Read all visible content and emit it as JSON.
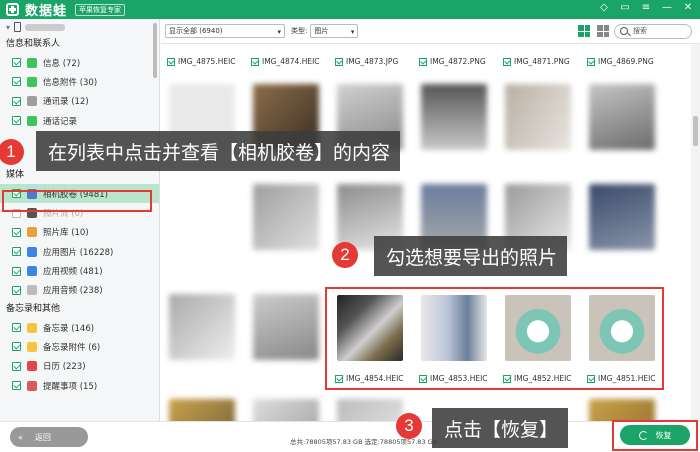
{
  "app": {
    "name": "数据蛙",
    "tag": "苹果恢复专家"
  },
  "window_buttons": [
    "diamond-icon",
    "chat-icon",
    "menu-icon",
    "minimize-icon",
    "close-icon"
  ],
  "sidebar": {
    "groups": [
      {
        "title": "信息和联系人",
        "items": [
          {
            "label": "信息 (72)",
            "checked": true,
            "color": "#3cc55c"
          },
          {
            "label": "信息附件 (30)",
            "checked": true,
            "color": "#3cc55c"
          },
          {
            "label": "通讯录 (12)",
            "checked": true,
            "color": "#9e9e9e"
          },
          {
            "label": "通话记录",
            "checked": true,
            "color": "#3cc55c"
          }
        ]
      },
      {
        "title": "媒体",
        "items": [
          {
            "label": "相机胶卷 (9481)",
            "checked": true,
            "color": "#4a7bd0",
            "active": true
          },
          {
            "label": "照片流 (0)",
            "checked": false,
            "color": "#555",
            "dim": true
          },
          {
            "label": "照片库 (10)",
            "checked": true,
            "color": "#e6a23c"
          },
          {
            "label": "应用图片 (16228)",
            "checked": true,
            "color": "#3b86e6"
          },
          {
            "label": "应用视频 (481)",
            "checked": true,
            "color": "#3b86e6"
          },
          {
            "label": "应用音频 (238)",
            "checked": true,
            "color": "#bbb"
          }
        ]
      },
      {
        "title": "备忘录和其他",
        "items": [
          {
            "label": "备忘录 (146)",
            "checked": true,
            "color": "#f5c542"
          },
          {
            "label": "备忘录附件 (6)",
            "checked": true,
            "color": "#f5c542"
          },
          {
            "label": "日历 (223)",
            "checked": true,
            "color": "#e04848"
          },
          {
            "label": "提醒事项 (15)",
            "checked": true,
            "color": "#d85a5a"
          }
        ]
      }
    ]
  },
  "toolbar": {
    "filter_value": "显示全部 (6940)",
    "type_label": "类型:",
    "type_value": "图片",
    "search_placeholder": "搜索"
  },
  "grid": {
    "top_labels": [
      "IMG_4875.HEIC",
      "IMG_4874.HEIC",
      "IMG_4873.JPG",
      "IMG_4872.PNG",
      "IMG_4871.PNG",
      "IMG_4869.PNG"
    ],
    "selected_labels": [
      "IMG_4854.HEIC",
      "IMG_4853.HEIC",
      "IMG_4852.HEIC",
      "IMG_4851.HEIC"
    ]
  },
  "bottom": {
    "back_label": "返回",
    "status": "总共:78805项57.83 GB 选定:78805项57.83 GB",
    "restore_label": "恢复"
  },
  "callouts": [
    {
      "num": "1",
      "text": "在列表中点击并查看【相机胶卷】的内容"
    },
    {
      "num": "2",
      "text": "勾选想要导出的照片"
    },
    {
      "num": "3",
      "text": "点击【恢复】"
    }
  ]
}
